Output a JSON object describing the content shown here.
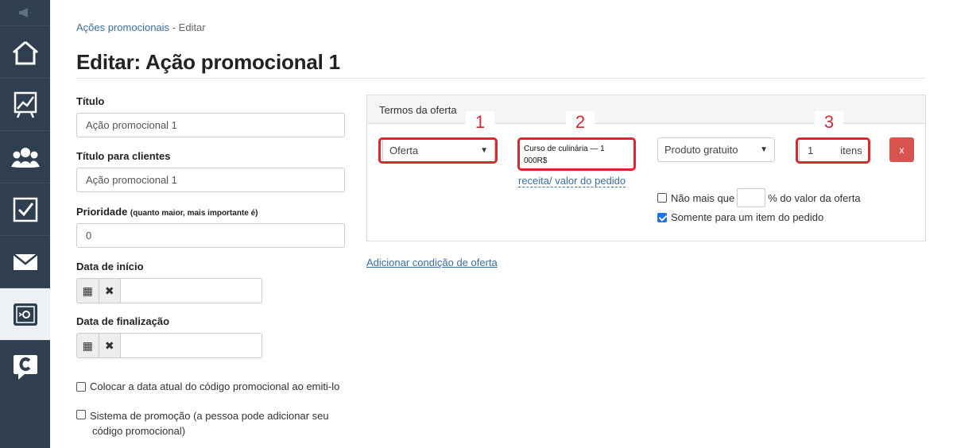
{
  "breadcrumb": {
    "parent": "Ações promocionais",
    "separator": "-",
    "current": "Editar"
  },
  "page_title": "Editar: Ação promocional 1",
  "form": {
    "title_label": "Título",
    "title_value": "Ação promocional 1",
    "client_title_label": "Título para clientes",
    "client_title_value": "Ação promocional 1",
    "priority_label": "Prioridade",
    "priority_hint": "(quanto maior, mais importante é)",
    "priority_value": "0",
    "start_date_label": "Data de início",
    "end_date_label": "Data de finalização",
    "calendar_glyph": "▦",
    "clear_glyph": "✖",
    "checkbox_date_label": "Colocar a data atual do código promocional ao emiti-lo",
    "checkbox_promo_label_1": "Sistema de promoção (a pessoa pode adicionar seu",
    "checkbox_promo_label_2": "código promocional)"
  },
  "offer": {
    "panel_title": "Termos da oferta",
    "type_select": "Oferta",
    "course_line1": "Curso de culinária — 1",
    "course_line2": "000R$",
    "revenue_link": "receita/ valor do pedido",
    "product_select": "Produto gratuito",
    "quantity_value": "1",
    "quantity_unit": "itens",
    "remove_label": "x",
    "max_pct_prefix": "Não mais que",
    "max_pct_suffix": "% do valor da oferta",
    "only_one_item_label": "Somente para um item do pedido",
    "only_one_item_checked": true,
    "max_pct_checked": false,
    "add_condition_link": "Adicionar condição de oferta"
  },
  "annotations": [
    "1",
    "2",
    "3"
  ],
  "colors": {
    "sidebar_bg": "#2f3f4f",
    "link": "#3b6fa0",
    "annotation_red": "#d9282f",
    "remove_button": "#d9534f"
  },
  "sidebar": {
    "icons": [
      "megaphone-icon",
      "home-icon",
      "chart-icon",
      "users-icon",
      "checkbox-icon",
      "mail-icon",
      "settings-icon",
      "chat-c-icon"
    ],
    "active_index": 5
  }
}
